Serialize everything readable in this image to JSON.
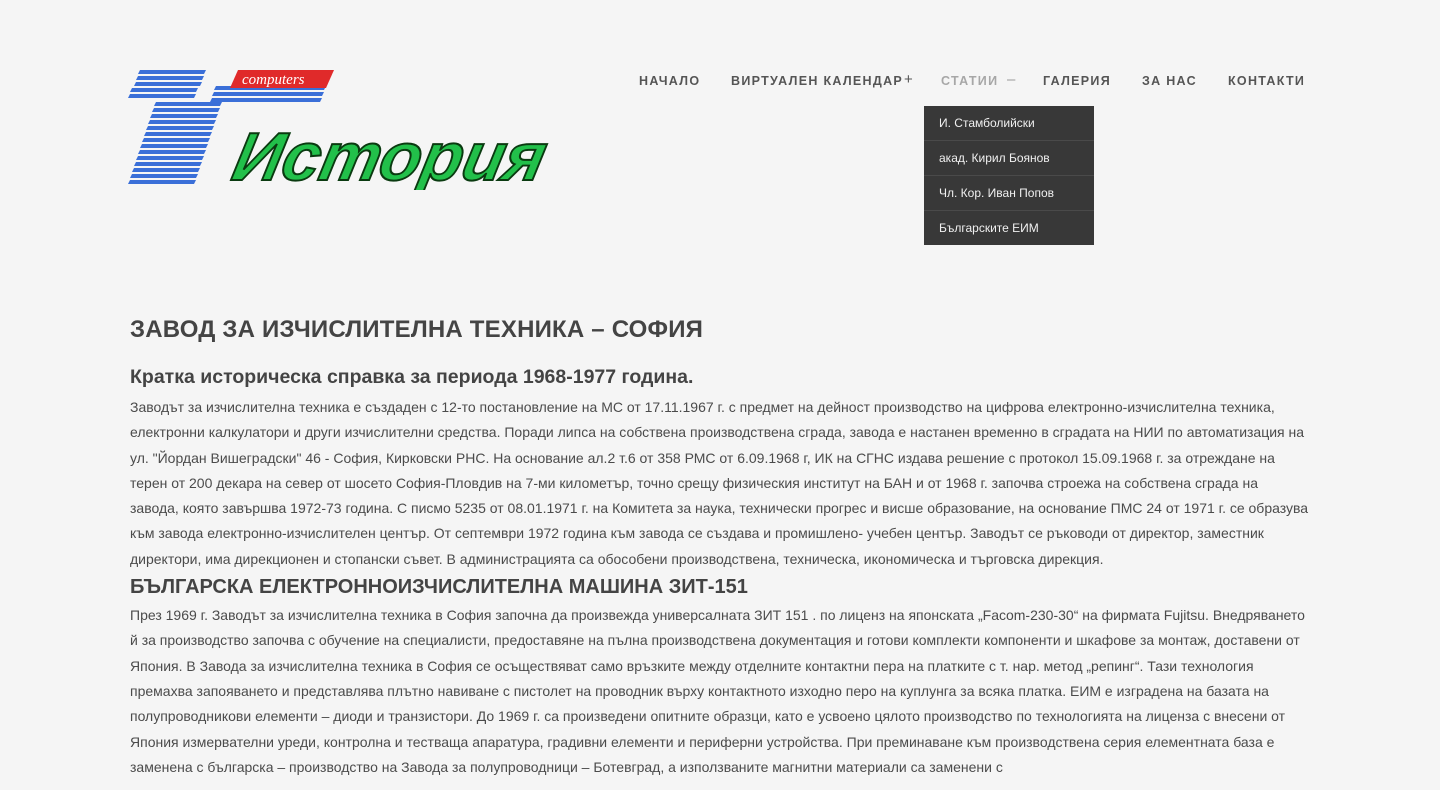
{
  "logo": {
    "top_text": "computers",
    "main_text": "История"
  },
  "nav": {
    "items": [
      {
        "label": "НАЧАЛО"
      },
      {
        "label": "ВИРТУАЛЕН КАЛЕНДАР",
        "sign": "+"
      },
      {
        "label": "СТАТИИ",
        "sign": "–"
      },
      {
        "label": "ГАЛЕРИЯ"
      },
      {
        "label": "ЗА НАС"
      },
      {
        "label": "КОНТАКТИ"
      }
    ],
    "active": "СТАТИИ"
  },
  "dropdown": {
    "items": [
      {
        "label": "И. Стамболийски"
      },
      {
        "label": "акад. Кирил Боянов"
      },
      {
        "label": "Чл. Кор. Иван Попов"
      },
      {
        "label": "Българските ЕИМ"
      }
    ]
  },
  "article": {
    "title": "ЗАВОД ЗА ИЗЧИСЛИТЕЛНА ТЕХНИКА – СОФИЯ",
    "subtitle": "Кратка историческа справка за периода 1968-1977 година.",
    "paragraph1": "Заводът за изчислителна техника е създаден с 12-то постановление на МС от 17.11.1967 г. с предмет на дейност производство на цифрова електронно-изчислителна техника, електронни калкулатори и други изчислителни средства. Поради липса на собствена производствена сграда, завода е настанен временно в сградата на НИИ по автоматизация на ул. \"Йордан Вишеградски\" 46 - София, Кирковски РНС. На основание ал.2 т.6 от 358 РМС от 6.09.1968 г, ИК на СГНС издава решение с протокол 15.09.1968 г. за отреждане на терен от 200 декара на север от шосето София-Пловдив на 7-ми километър, точно срещу физическия институт на БАН и от 1968 г. започва строежа на собствена сграда на завода, която завършва 1972-73 година. С писмо 5235 от 08.01.1971 г. на Комитета за наука, технически прогрес и висше образование, на основание ПМС 24 от 1971 г. се образува към завода електронно-изчислителен център. От септември 1972 година към завода се създава и промишлено- учебен център. Заводът се ръководи от директор, заместник директори, има дирекционен и стопански съвет. В администрацията са обособени производствена, техническа, икономическа и търговска дирекция.",
    "section_title": "БЪЛГАРСКА ЕЛЕКТРОННОИЗЧИСЛИТЕЛНА МАШИНА ЗИТ-151",
    "paragraph2": "През 1969 г. Заводът за изчислителна техника в София започна да произвежда универсалната ЗИТ 151 . по лиценз на японската „Facom-230-30“ на фирмата Fujitsu. Внедряването й за производство започва с обучение на специалисти, предоставяне на пълна производствена документация и готови комплекти компоненти и шкафове за монтаж, доставени от Япония. В Завода за изчислителна техника в София се осъществяват само връзките между отделните контактни пера на платките с т. нар. метод „репинг“. Тази технология премахва запояването и представлява плътно навиване с пистолет на проводник върху контактното изходно перо на куплунга за всяка платка. ЕИМ е изградена на базата на полупроводникови елементи – диоди и транзистори. До 1969 г. са произведени опитните образци, като е усвоено цялото производство по технологията на лиценза с внесени от Япония измервателни уреди, контролна и тестваща апаратура, градивни елементи и периферни устройства. При преминаване към производствена серия елементната база е заменена с българска – производство на Завода за полупроводници – Ботевград, а използваните магнитни материали са заменени с"
  }
}
